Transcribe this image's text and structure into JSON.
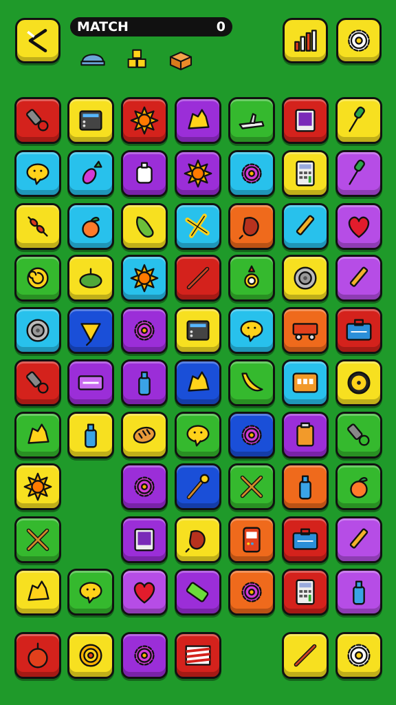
{
  "hud": {
    "label": "MATCH",
    "score": "0"
  },
  "colors": {
    "background": "#1f9a2a",
    "red": "#d4221c",
    "yellow": "#f7e020",
    "purple": "#9b2ed8",
    "green": "#35b92e",
    "cyan": "#28c1ec",
    "orange": "#ef6a1c",
    "blue": "#1a4fd8",
    "violet": "#b64de6"
  },
  "board": {
    "rows": [
      [
        {
          "c": "red",
          "i": "wrench-icon"
        },
        {
          "c": "yellow",
          "i": "device-icon"
        },
        {
          "c": "red",
          "i": "sun-icon"
        },
        {
          "c": "purple",
          "i": "leaf-icon"
        },
        {
          "c": "green",
          "i": "plane-icon"
        },
        {
          "c": "red",
          "i": "tablet-icon"
        },
        {
          "c": "yellow",
          "i": "brush-icon"
        }
      ],
      [
        {
          "c": "cyan",
          "i": "face-icon"
        },
        {
          "c": "cyan",
          "i": "radish-icon"
        },
        {
          "c": "purple",
          "i": "bag-icon"
        },
        {
          "c": "purple",
          "i": "sun-icon"
        },
        {
          "c": "cyan",
          "i": "gear-icon"
        },
        {
          "c": "yellow",
          "i": "calculator-icon"
        },
        {
          "c": "violet",
          "i": "brush-icon"
        }
      ],
      [
        {
          "c": "yellow",
          "i": "skewer-icon"
        },
        {
          "c": "cyan",
          "i": "fruit-icon"
        },
        {
          "c": "yellow",
          "i": "pear-icon"
        },
        {
          "c": "cyan",
          "i": "star-icon"
        },
        {
          "c": "orange",
          "i": "berry-icon"
        },
        {
          "c": "cyan",
          "i": "pen-icon"
        },
        {
          "c": "violet",
          "i": "heart-icon"
        }
      ],
      [
        {
          "c": "green",
          "i": "spiral-icon"
        },
        {
          "c": "yellow",
          "i": "melon-icon"
        },
        {
          "c": "cyan",
          "i": "sun-icon"
        },
        {
          "c": "red",
          "i": "stick-icon"
        },
        {
          "c": "green",
          "i": "ring-icon"
        },
        {
          "c": "yellow",
          "i": "disc-icon"
        },
        {
          "c": "violet",
          "i": "pen-icon"
        }
      ],
      [
        {
          "c": "cyan",
          "i": "disc-icon"
        },
        {
          "c": "blue",
          "i": "cone-icon"
        },
        {
          "c": "purple",
          "i": "gear-icon"
        },
        {
          "c": "yellow",
          "i": "device-icon"
        },
        {
          "c": "cyan",
          "i": "face-icon"
        },
        {
          "c": "orange",
          "i": "cart-icon"
        },
        {
          "c": "red",
          "i": "card-icon"
        }
      ],
      [
        {
          "c": "red",
          "i": "wrench-icon"
        },
        {
          "c": "purple",
          "i": "radio-icon"
        },
        {
          "c": "purple",
          "i": "bottle-icon"
        },
        {
          "c": "blue",
          "i": "leaf-icon"
        },
        {
          "c": "green",
          "i": "banana-icon"
        },
        {
          "c": "cyan",
          "i": "panel-icon"
        },
        {
          "c": "yellow",
          "i": "dial-icon"
        }
      ],
      [
        {
          "c": "green",
          "i": "leaf-icon"
        },
        {
          "c": "yellow",
          "i": "bottle-icon"
        },
        {
          "c": "yellow",
          "i": "bread-icon"
        },
        {
          "c": "green",
          "i": "face-icon"
        },
        {
          "c": "blue",
          "i": "gear-icon"
        },
        {
          "c": "purple",
          "i": "clipboard-icon"
        },
        {
          "c": "green",
          "i": "wrench-icon"
        }
      ],
      [
        {
          "c": "yellow",
          "i": "sun-icon"
        },
        null,
        {
          "c": "purple",
          "i": "gear-icon"
        },
        {
          "c": "blue",
          "i": "torch-icon"
        },
        {
          "c": "green",
          "i": "crossed-icon"
        },
        {
          "c": "orange",
          "i": "bottle-icon"
        },
        {
          "c": "green",
          "i": "fruit-icon"
        }
      ],
      [
        {
          "c": "green",
          "i": "crossed-icon"
        },
        null,
        {
          "c": "purple",
          "i": "tablet-icon"
        },
        {
          "c": "yellow",
          "i": "berry-icon"
        },
        {
          "c": "orange",
          "i": "machine-icon"
        },
        {
          "c": "red",
          "i": "card-icon"
        },
        {
          "c": "violet",
          "i": "pen-icon"
        }
      ],
      [
        {
          "c": "yellow",
          "i": "leaf-icon"
        },
        {
          "c": "green",
          "i": "face-icon"
        },
        {
          "c": "violet",
          "i": "heart-icon"
        },
        {
          "c": "purple",
          "i": "battery-icon"
        },
        {
          "c": "orange",
          "i": "gear-icon"
        },
        {
          "c": "red",
          "i": "calculator-icon"
        },
        {
          "c": "violet",
          "i": "bottle-icon"
        }
      ]
    ]
  },
  "top_left": {
    "c": "yellow",
    "i": "back-icon"
  },
  "top_right": [
    {
      "c": "yellow",
      "i": "chart-icon"
    },
    {
      "c": "yellow",
      "i": "settings-icon"
    }
  ],
  "collected": [
    "dome-icon",
    "crates-icon",
    "box-icon"
  ],
  "bottom_left": [
    {
      "c": "red",
      "i": "bomb-icon"
    },
    {
      "c": "yellow",
      "i": "target-icon"
    },
    {
      "c": "purple",
      "i": "gear-icon"
    },
    {
      "c": "red",
      "i": "flag-icon"
    }
  ],
  "bottom_right": [
    {
      "c": "yellow",
      "i": "stick-icon"
    },
    {
      "c": "yellow",
      "i": "settings-icon"
    }
  ]
}
